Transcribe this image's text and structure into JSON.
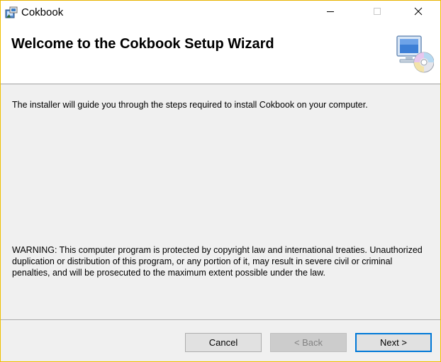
{
  "window": {
    "title": "Cokbook"
  },
  "header": {
    "title": "Welcome to the Cokbook Setup Wizard"
  },
  "body": {
    "intro": "The installer will guide you through the steps required to install Cokbook on your computer.",
    "warning": "WARNING: This computer program is protected by copyright law and international treaties. Unauthorized duplication or distribution of this program, or any portion of it, may result in severe civil or criminal penalties, and will be prosecuted to the maximum extent possible under the law."
  },
  "buttons": {
    "cancel": "Cancel",
    "back": "< Back",
    "next": "Next >"
  },
  "icons": {
    "app": "installer-icon",
    "setup": "computer-disc-icon",
    "minimize": "minimize-icon",
    "maximize": "maximize-icon",
    "close": "close-icon"
  },
  "colors": {
    "window_border": "#f0c000",
    "focus_border": "#0078d7",
    "dialog_background": "#f0f0f0"
  }
}
